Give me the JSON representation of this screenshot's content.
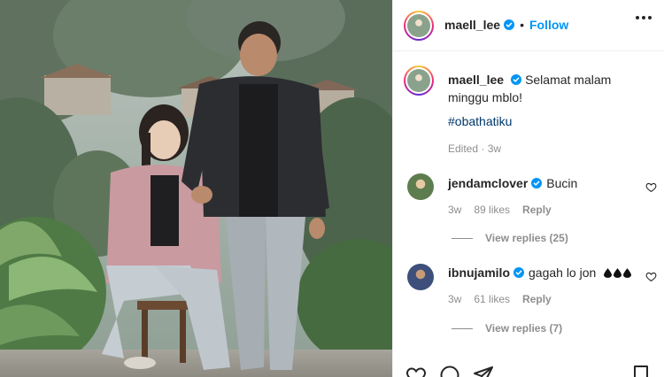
{
  "post": {
    "username": "maell_lee",
    "follow_label": "Follow",
    "separator": "•",
    "caption": "Selamat malam minggu mblo!",
    "hashtag": "#obathatiku",
    "edited_time": "Edited · 3w"
  },
  "comments": [
    {
      "username": "jendamclover",
      "text": "Bucin",
      "time": "3w",
      "likes": "89 likes",
      "reply_label": "Reply",
      "view_replies": "View replies (25)"
    },
    {
      "username": "ibnujamilo",
      "text": "gagah lo jon",
      "time": "3w",
      "likes": "61 likes",
      "reply_label": "Reply",
      "view_replies": "View replies (7)"
    }
  ],
  "icons": {
    "verified": "verified-badge-icon",
    "more": "more-options-icon",
    "heart": "heart-icon",
    "comment": "comment-icon",
    "share": "share-icon",
    "bookmark": "bookmark-icon"
  },
  "colors": {
    "accent_link": "#0095f6",
    "hashtag": "#00376b",
    "muted": "#8e8e8e",
    "text": "#262626"
  }
}
